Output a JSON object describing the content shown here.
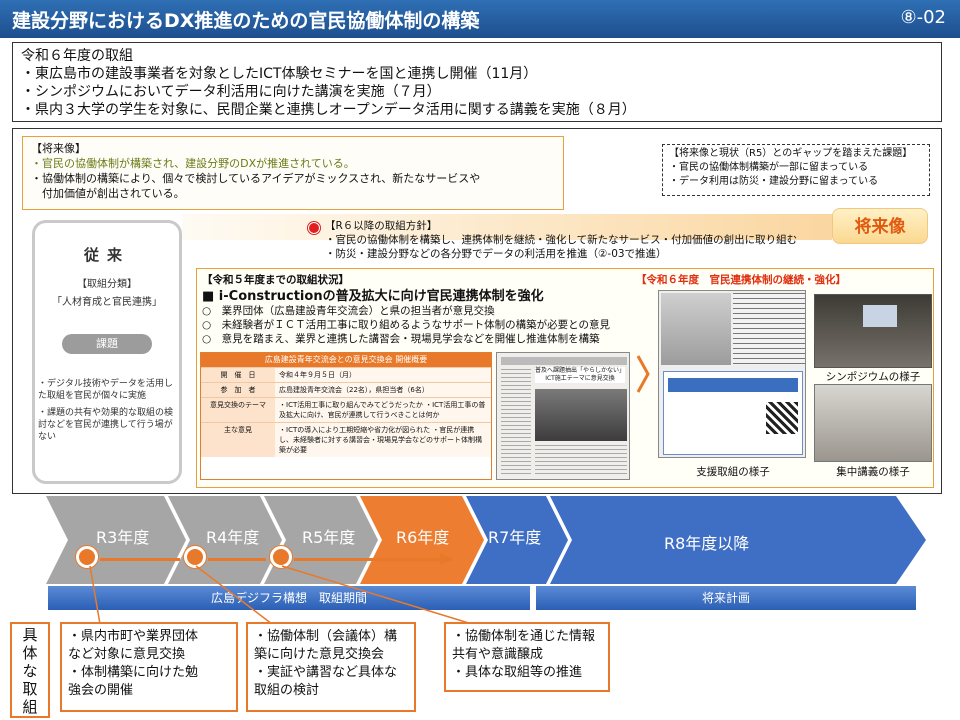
{
  "header": {
    "title": "建設分野におけるDX推進のための官民協働体制の構築",
    "page_number": "⑧-02"
  },
  "r6_actions": {
    "heading": "令和６年度の取組",
    "items": [
      "・東広島市の建設事業者を対象としたICT体験セミナーを国と連携し開催（11月）",
      "・シンポジウムにおいてデータ利活用に向けた講演を実施（７月）",
      "・県内３大学の学生を対象に、民間企業と連携しオープンデータ活用に関する講義を実施（８月）"
    ]
  },
  "vision": {
    "heading": "【将来像】",
    "line1": "・官民の協働体制が構築され、建設分野のDXが推進されている。",
    "line2": "・協働体制の構築により、個々で検討しているアイデアがミックスされ、新たなサービスや",
    "line3": "　付加価値が創出されている。"
  },
  "gap": {
    "heading": "【将来像と現状（R5）とのギャップを踏まえた課題】",
    "items": [
      "・官民の協働体制構築が一部に留まっている",
      "・データ利用は防災・建設分野に留まっている"
    ]
  },
  "future_badge": "将来像",
  "policy": {
    "heading": "【R６以降の取組方針】",
    "items": [
      "・官民の協働体制を構築し、連携体制を継続・強化して新たなサービス・付加価値の創出に取り組む",
      "・防災・建設分野などの各分野でデータの利活用を推進（②-03で推進）"
    ]
  },
  "conventional": {
    "title": "従来",
    "category_label": "【取組分類】",
    "category_value": "「人材育成と官民連携」",
    "issue_pill": "課題",
    "issues": [
      "・デジタル技術やデータを活用した取組を官民が個々に実施",
      "・課題の共有や効果的な取組の検討などを官民が連携して行う場がない"
    ]
  },
  "r5_status": {
    "heading": "【令和５年度までの取組状況】",
    "main": "■ i-Constructionの普及拡大に向け官民連携体制を強化",
    "items": [
      "○　業界団体（広島建設青年交流会）と県の担当者が意見交換",
      "○　未経験者がＩＣＴ活用工事に取り組めるようなサポート体制の構築が必要との意見",
      "○　意見を踏まえ、業界と連携した講習会・現場見学会などを開催し推進体制を構築"
    ]
  },
  "exchange_table": {
    "title": "広島建設青年交流会との意見交換会 開催概要",
    "rows": [
      {
        "k": "開　催　日",
        "v": "令和４年９月５日（月）"
      },
      {
        "k": "参　加　者",
        "v": "広島建設青年交流会（22名），県担当者（6名）"
      },
      {
        "k": "意見交換のテーマ",
        "v": "・ICT活用工事に取り組んでみてどうだったか ・ICT活用工事の普及拡大に向け、官民が連携して行うべきことは何か"
      },
      {
        "k": "主な意見",
        "v": "・ICTの導入により工期短縮や省力化が図られた ・官民が連携し、未経験者に対する講習会・現場見学会などのサポート体制構築が必要"
      }
    ]
  },
  "news_clip": {
    "headline": "普及へ課題抽出「やらしかない」ICT施工テーマに意見交換"
  },
  "r6_status": {
    "heading": "【令和６年度　官民連携体制の継続・強化】",
    "support_caption": "支援取組の様子",
    "symposium_caption": "シンポジウムの様子",
    "lecture_caption": "集中講義の様子"
  },
  "timeline": {
    "stages": [
      "R3年度",
      "R4年度",
      "R5年度",
      "R6年度",
      "R7年度",
      "R8年度以降"
    ],
    "plan_bar": "広島デジフラ構想　取組期間",
    "future_bar": "将来計画"
  },
  "concrete": {
    "label_chars": [
      "具",
      "体",
      "な",
      "取",
      "組"
    ],
    "box1": [
      "・県内市町や業界団体",
      "など対象に意見交換",
      "・体制構築に向けた勉",
      "強会の開催"
    ],
    "box2": [
      "・協働体制（会議体）構",
      "築に向けた意見交換会",
      "・実証や講習など具体な",
      "取組の検討"
    ],
    "box3": [
      "・協働体制を通じた情報",
      "共有や意識醸成",
      "・具体な取組等の推進"
    ]
  },
  "colors": {
    "header_blue": "#1d4f8f",
    "accent_orange": "#e8792a",
    "timeline_gray": "#a6a6a6",
    "timeline_blue": "#3f6fc4"
  }
}
